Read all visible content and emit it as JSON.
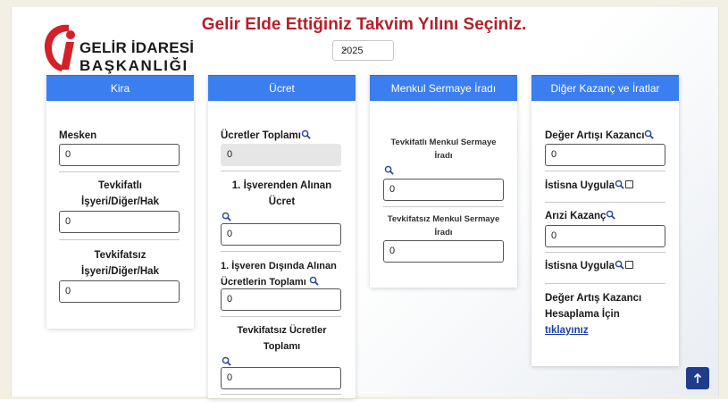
{
  "title": "Gelir Elde Ettiğiniz Takvim Yılını Seçiniz.",
  "logo": {
    "line1": "GELİR İDARESİ",
    "line2": "BAŞKANLIĞI"
  },
  "year_select": {
    "value": "2025"
  },
  "cards": {
    "kira": {
      "header": "Kira",
      "mesken_label": "Mesken",
      "mesken_value": "0",
      "tevkifatli_label_1": "Tevkifatlı",
      "tevkifatli_label_2": "İşyeri/Diğer/Hak",
      "tevkifatli_value": "0",
      "tevkifatsiz_label_1": "Tevkifatsız",
      "tevkifatsiz_label_2": "İşyeri/Diğer/Hak",
      "tevkifatsiz_value": "0"
    },
    "ucret": {
      "header": "Ücret",
      "toplami_label": "Ücretler Toplamı",
      "toplami_value": "0",
      "isveren_label_1": "1. İşverenden Alınan",
      "isveren_label_2": "Ücret",
      "isveren_value": "0",
      "disinda_label_1": "1. İşveren Dışında Alınan",
      "disinda_label_2": "Ücretlerin Toplamı",
      "disinda_value": "0",
      "tevkifatsiz_label_1": "Tevkifatsız Ücretler",
      "tevkifatsiz_label_2": "Toplamı",
      "tevkifatsiz_value": "0"
    },
    "menkul": {
      "header": "Menkul Sermaye İradı",
      "tevkifatli_label_1": "Tevkifatlı Menkul Sermaye",
      "tevkifatli_label_2": "İradı",
      "tevkifatli_value": "0",
      "tevkifatsiz_label_1": "Tevkifatsız Menkul Sermaye",
      "tevkifatsiz_label_2": "İradı",
      "tevkifatsiz_value": "0"
    },
    "diger": {
      "header": "Diğer Kazanç ve İratlar",
      "deger_label": "Değer Artışı Kazancı",
      "deger_value": "0",
      "istisna1_label": "İstisna Uygula",
      "arizi_label": "Arızi Kazanç",
      "arizi_value": "0",
      "istisna2_label": "İstisna Uygula",
      "hesap_label_1": "Değer Artış Kazancı",
      "hesap_label_2": "Hesaplama İçin",
      "hesap_link": "tıklayınız"
    }
  },
  "icons": {
    "search": "search-icon",
    "checkbox": "checkbox-icon",
    "arrow_up": "arrow-up-icon",
    "logo": "gib-logo-icon"
  },
  "colors": {
    "title": "#b5202a",
    "header_bg": "#3b7ef0",
    "link": "#1a3fa8",
    "top_button": "#203c8c"
  }
}
